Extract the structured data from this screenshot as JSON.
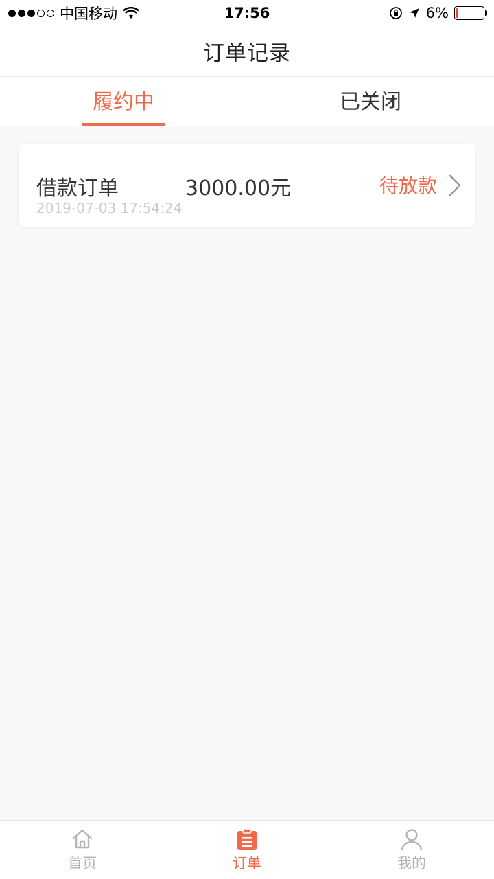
{
  "status_bar": {
    "carrier": "中国移动",
    "time": "17:56",
    "battery_percent": "6%",
    "battery_level": 0.06,
    "signal_bars_filled": 3,
    "signal_bars_total": 5,
    "icons": [
      "wifi-icon",
      "orientation-lock-icon",
      "location-arrow-icon",
      "battery-icon"
    ]
  },
  "nav": {
    "title": "订单记录"
  },
  "tabs": [
    {
      "label": "履约中",
      "active": true
    },
    {
      "label": "已关闭",
      "active": false
    }
  ],
  "orders": [
    {
      "type": "借款订单",
      "amount": "3000.00元",
      "status": "待放款",
      "time": "2019-07-03 17:54:24"
    }
  ],
  "tab_bar": [
    {
      "label": "首页",
      "icon": "home-icon",
      "active": false
    },
    {
      "label": "订单",
      "icon": "order-clipboard-icon",
      "active": true
    },
    {
      "label": "我的",
      "icon": "user-icon",
      "active": false
    }
  ],
  "colors": {
    "accent": "#ee6a4a",
    "background": "#f7f8fa",
    "inactive": "#b5b5b5",
    "text": "#333333"
  }
}
